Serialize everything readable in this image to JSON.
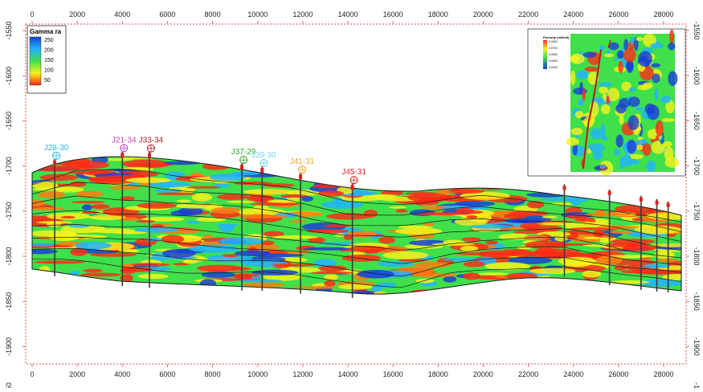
{
  "x_ticks": [
    "0",
    "2000",
    "4000",
    "6000",
    "8000",
    "10000",
    "12000",
    "14000",
    "16000",
    "18000",
    "20000",
    "22000",
    "24000",
    "26000",
    "28000"
  ],
  "y_ticks": [
    "-1550",
    "-1600",
    "-1650",
    "-1700",
    "-1750",
    "-1800",
    "-1850",
    "-1900",
    "-1950"
  ],
  "legend": {
    "title": "Gamma ra",
    "labels": [
      "250",
      "200",
      "150",
      "100",
      "50"
    ],
    "colors": [
      "#1a3fd6",
      "#22b3ff",
      "#3fe04a",
      "#f6f21a",
      "#ff2a16"
    ]
  },
  "wells": [
    {
      "name": "J28-30",
      "color": "#26b7e6",
      "x": 1000
    },
    {
      "name": "J21-34",
      "color": "#c43fbd",
      "x": 4000
    },
    {
      "name": "J33-34",
      "color": "#b41a23",
      "x": 5200
    },
    {
      "name": "J37-29",
      "color": "#28a828",
      "x": 9300
    },
    {
      "name": "J39-30",
      "color": "#6fd2e8",
      "x": 10200
    },
    {
      "name": "J41-31",
      "color": "#f4a21e",
      "x": 11900
    },
    {
      "name": "J45-31",
      "color": "#d6231e",
      "x": 14200
    }
  ],
  "inset": {
    "title": "Porosity (m3/m3)",
    "labels": [
      "0.0900",
      "0.0700",
      "0.0500",
      "0.0300",
      "0.0100"
    ]
  }
}
